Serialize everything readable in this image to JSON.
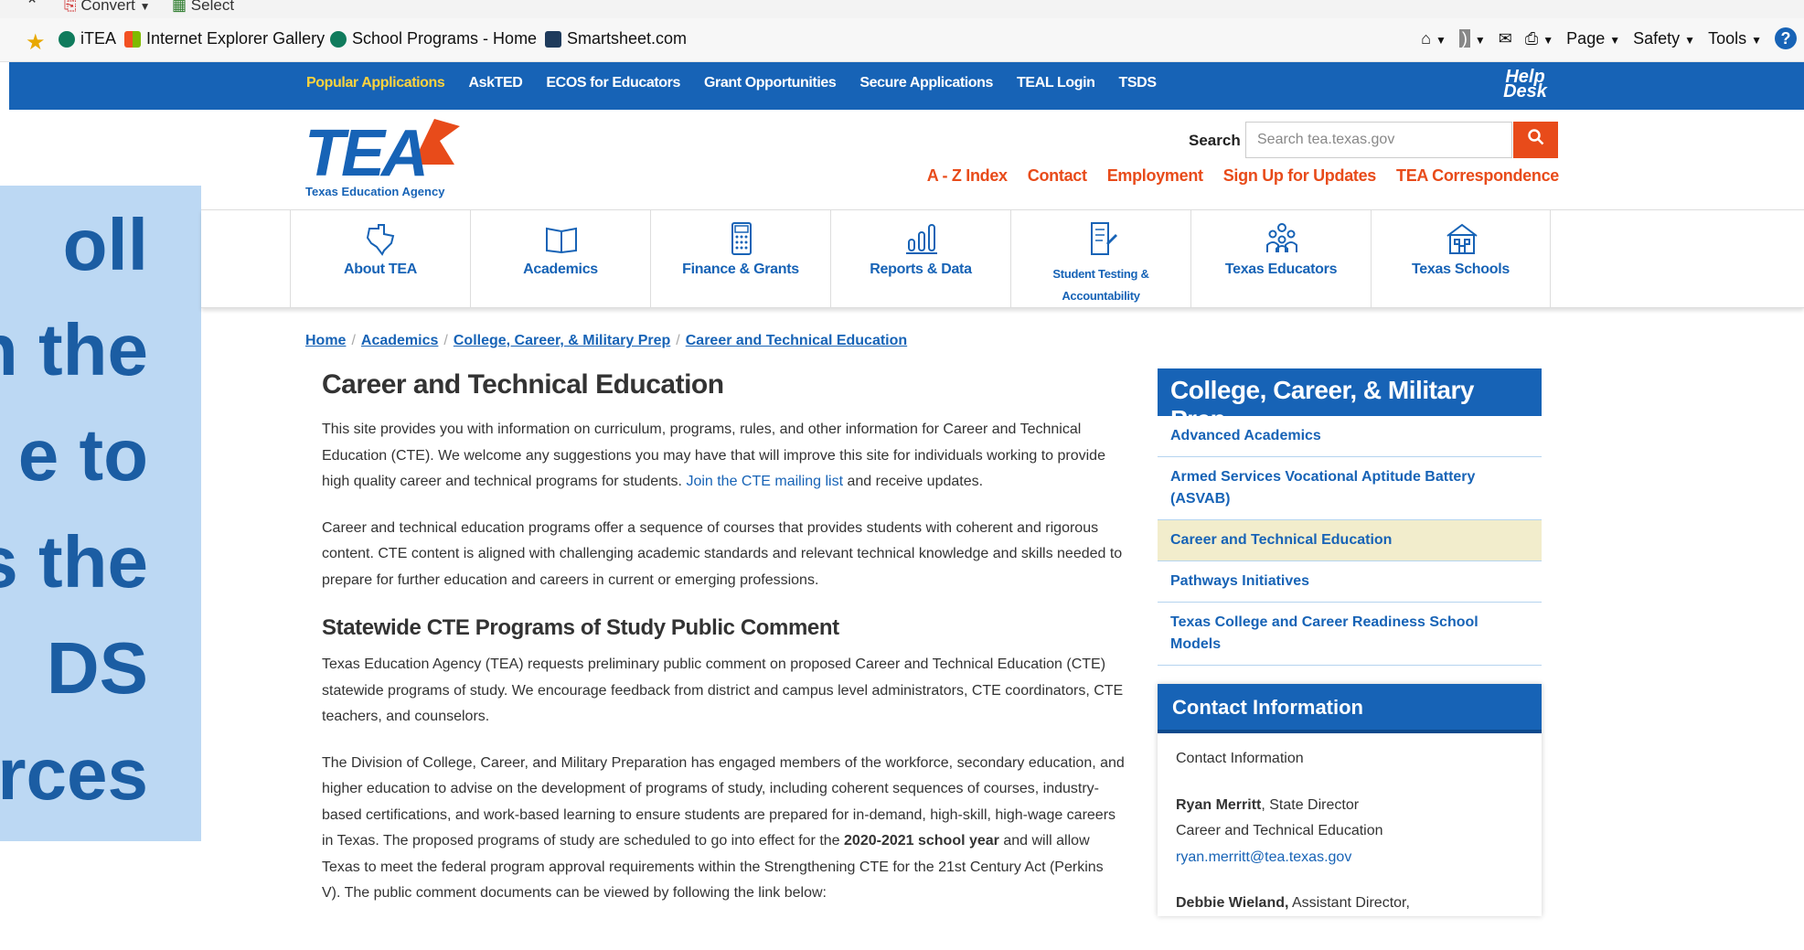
{
  "browser": {
    "top_items": [
      "Convert",
      "Select"
    ],
    "favorites": [
      "iTEA",
      "Internet Explorer Gallery",
      "School Programs - Home",
      "Smartsheet.com"
    ],
    "tools": [
      "Page",
      "Safety",
      "Tools"
    ]
  },
  "topbar": {
    "links": [
      "Popular Applications",
      "AskTED",
      "ECOS for Educators",
      "Grant Opportunities",
      "Secure Applications",
      "TEAL Login",
      "TSDS"
    ],
    "helpdesk": [
      "Help",
      "Desk"
    ]
  },
  "overlay": {
    "lines": [
      "oll",
      "n the",
      "e to",
      "s the",
      "DS",
      "rces"
    ]
  },
  "header": {
    "logo_letters": "TEA",
    "logo_tagline": "Texas Education Agency",
    "search_label": "Search",
    "search_placeholder": "Search tea.texas.gov",
    "utility": [
      "A - Z Index",
      "Contact",
      "Employment",
      "Sign Up for Updates",
      "TEA Correspondence"
    ]
  },
  "nav": [
    {
      "label": "About TEA",
      "icon": "texas-map-icon"
    },
    {
      "label": "Academics",
      "icon": "open-book-icon"
    },
    {
      "label": "Finance & Grants",
      "icon": "calculator-icon"
    },
    {
      "label": "Reports & Data",
      "icon": "bar-chart-icon"
    },
    {
      "label": "Student Testing & Accountability",
      "icon": "test-document-icon"
    },
    {
      "label": "Texas Educators",
      "icon": "educators-icon"
    },
    {
      "label": "Texas Schools",
      "icon": "school-building-icon"
    }
  ],
  "breadcrumb": [
    "Home",
    "Academics",
    "College, Career, & Military Prep",
    "Career and Technical Education"
  ],
  "content": {
    "title": "Career and Technical Education",
    "p1": "This site provides you with information on curriculum, programs, rules, and other information for Career and Technical Education (CTE). We welcome any suggestions you may have that will improve this site for individuals working to provide high quality career and technical programs for students. ",
    "p1_link": "Join the CTE mailing list",
    "p1_end": " and receive updates.",
    "p2": "Career and technical education programs offer a sequence of courses that provides students with coherent and rigorous content. CTE content is aligned with challenging academic standards and relevant technical knowledge and skills needed to prepare for further education and careers in current or emerging professions.",
    "h2": "Statewide CTE Programs of Study Public Comment",
    "p3": "Texas Education Agency (TEA) requests preliminary public comment on proposed Career and Technical Education (CTE) statewide programs of study. We encourage feedback from district and campus level administrators, CTE coordinators, CTE teachers, and counselors.",
    "p4_a": "The Division of College, Career, and Military Preparation has engaged members of the workforce, secondary education, and higher education to advise on the development of programs of study, including coherent sequences of courses, industry-based certifications, and work-based learning to ensure students are prepared for in-demand, high-skill, high-wage careers in Texas. The proposed programs of study are scheduled to go into effect for the ",
    "p4_bold": "2020-2021 school year",
    "p4_b": " and will allow Texas to meet the federal program approval requirements within the Strengthening CTE for the 21st Century Act (Perkins V).  The public comment documents can be viewed by following the link below:"
  },
  "sidebar": {
    "title": "College, Career, & Military Prep",
    "items": [
      "Advanced Academics",
      "Armed Services Vocational Aptitude Battery (ASVAB)",
      "Career and Technical Education",
      "Pathways Initiatives",
      "Texas College and Career Readiness School Models"
    ],
    "active_index": 2
  },
  "contact": {
    "title": "Contact Information",
    "subtitle": "Contact Information",
    "person1_name": "Ryan Merritt",
    "person1_role": ", State Director",
    "person1_dept": "Career and Technical Education",
    "person1_email": "ryan.merritt@tea.texas.gov",
    "person2_name": "Debbie Wieland,",
    "person2_role": " Assistant Director,"
  },
  "colors": {
    "brand_blue": "#1763b6",
    "accent_orange": "#e84b1a",
    "overlay_bg": "#bcd8f3",
    "active_bg": "#f2edcc"
  }
}
